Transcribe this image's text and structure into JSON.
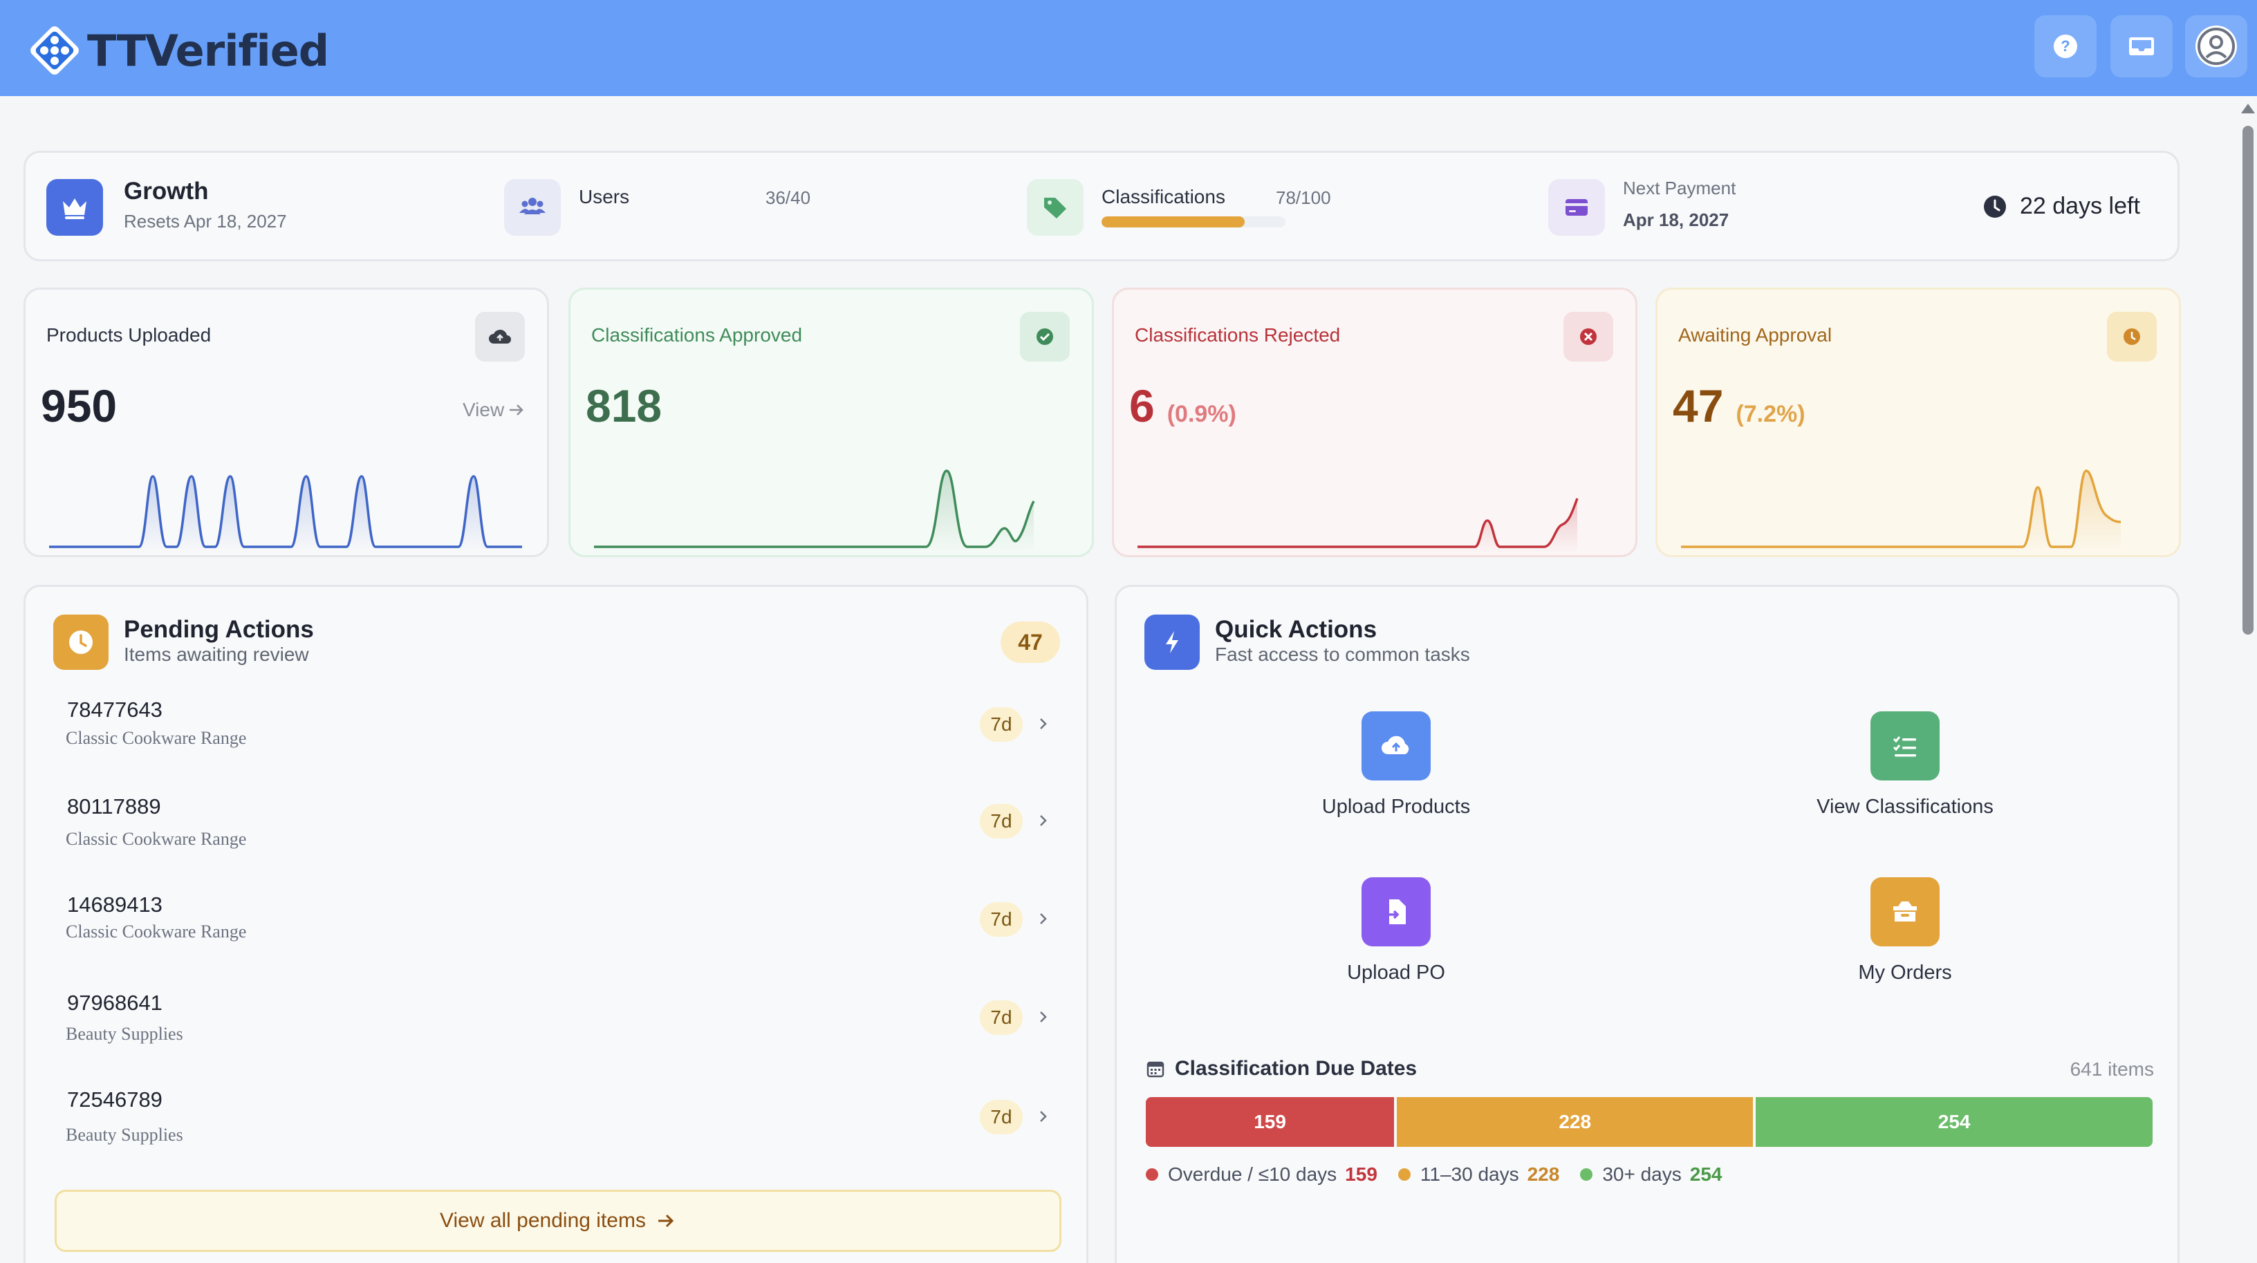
{
  "app": {
    "name": "TTVerified"
  },
  "header": {
    "icons": [
      "help-icon",
      "inbox-icon",
      "user-avatar-icon"
    ]
  },
  "plan": {
    "name": "Growth",
    "resets": "Resets Apr 18, 2027",
    "users_label": "Users",
    "users_count": "36/40",
    "class_label": "Classifications",
    "class_count": "78/100",
    "class_progress": 0.78,
    "payment_label": "Next Payment",
    "payment_date": "Apr 18, 2027",
    "days_left": "22 days left"
  },
  "stats": {
    "uploaded": {
      "title": "Products Uploaded",
      "value": "950",
      "link": "View",
      "color": "#3f66c7"
    },
    "approved": {
      "title": "Classifications Approved",
      "value": "818",
      "color": "#3f8c5a"
    },
    "rejected": {
      "title": "Classifications Rejected",
      "value": "6",
      "pct": "(0.9%)",
      "color": "#b8323a"
    },
    "awaiting": {
      "title": "Awaiting Approval",
      "value": "47",
      "pct": "(7.2%)",
      "color": "#a0661c"
    }
  },
  "pending": {
    "title": "Pending Actions",
    "subtitle": "Items awaiting review",
    "count": "47",
    "items": [
      {
        "id": "78477643",
        "desc": "Classic Cookware Range",
        "age": "7d"
      },
      {
        "id": "80117889",
        "desc": "Classic Cookware Range",
        "age": "7d"
      },
      {
        "id": "14689413",
        "desc": "Classic Cookware Range",
        "age": "7d"
      },
      {
        "id": "97968641",
        "desc": "Beauty Supplies",
        "age": "7d"
      },
      {
        "id": "72546789",
        "desc": "Beauty Supplies",
        "age": "7d"
      }
    ],
    "view_all": "View all pending items"
  },
  "quick": {
    "title": "Quick Actions",
    "subtitle": "Fast access to common tasks",
    "actions": [
      {
        "label": "Upload Products",
        "icon": "cloud-upload-icon",
        "color": "#5b8cf0"
      },
      {
        "label": "View Classifications",
        "icon": "checklist-icon",
        "color": "#57b07a"
      },
      {
        "label": "Upload PO",
        "icon": "file-import-icon",
        "color": "#8b5cf0"
      },
      {
        "label": "My Orders",
        "icon": "box-icon",
        "color": "#e3a43c"
      }
    ]
  },
  "due": {
    "title": "Classification Due Dates",
    "total": "641 items",
    "segments": [
      {
        "label": "Overdue / ≤10 days",
        "value": 159,
        "text": "159",
        "color": "#d0494a"
      },
      {
        "label": "11–30 days",
        "value": 228,
        "text": "228",
        "color": "#e3a43c"
      },
      {
        "label": "30+ days",
        "value": 254,
        "text": "254",
        "color": "#6cbd6a"
      }
    ]
  }
}
